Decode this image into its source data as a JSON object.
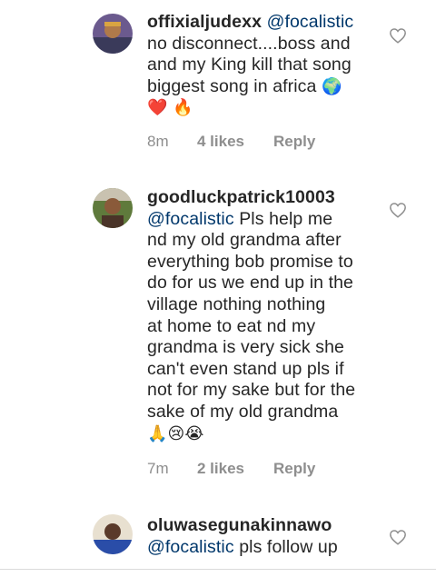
{
  "comments": [
    {
      "username": "offixialjudexx",
      "mention": "@focalistic",
      "lines": [
        "no disconnect....boss and",
        "and my King kill that song",
        "biggest song in africa "
      ],
      "emoji_after_line3": "🌍",
      "emoji_line": [
        "❤️",
        "🔥"
      ],
      "time": "8m",
      "likes": "4 likes",
      "reply": "Reply",
      "avatar_colors": [
        "#6b5a8e",
        "#d9a441",
        "#3a3a5a"
      ]
    },
    {
      "username": "goodluckpatrick10003",
      "mention": "@focalistic",
      "first_line_rest": " Pls help me",
      "lines": [
        "nd my old grandma after",
        "everything bob promise to",
        "do for us we end up in the",
        "village nothing nothing",
        "at home to eat nd my",
        "grandma is very sick she",
        "can't even stand up pls if",
        "not for my sake but for the",
        "sake of my old grandma"
      ],
      "emoji_line": [
        "🙏",
        "😢",
        "😭"
      ],
      "time": "7m",
      "likes": "2 likes",
      "reply": "Reply",
      "avatar_colors": [
        "#5f7a3c",
        "#8a5a3a",
        "#c9c2b0"
      ]
    },
    {
      "username": "oluwasegunakinnawo",
      "mention": "@focalistic",
      "first_line_rest": " pls follow up",
      "avatar_colors": [
        "#2a4da8",
        "#5a3a2a",
        "#e8e0d0"
      ]
    }
  ]
}
